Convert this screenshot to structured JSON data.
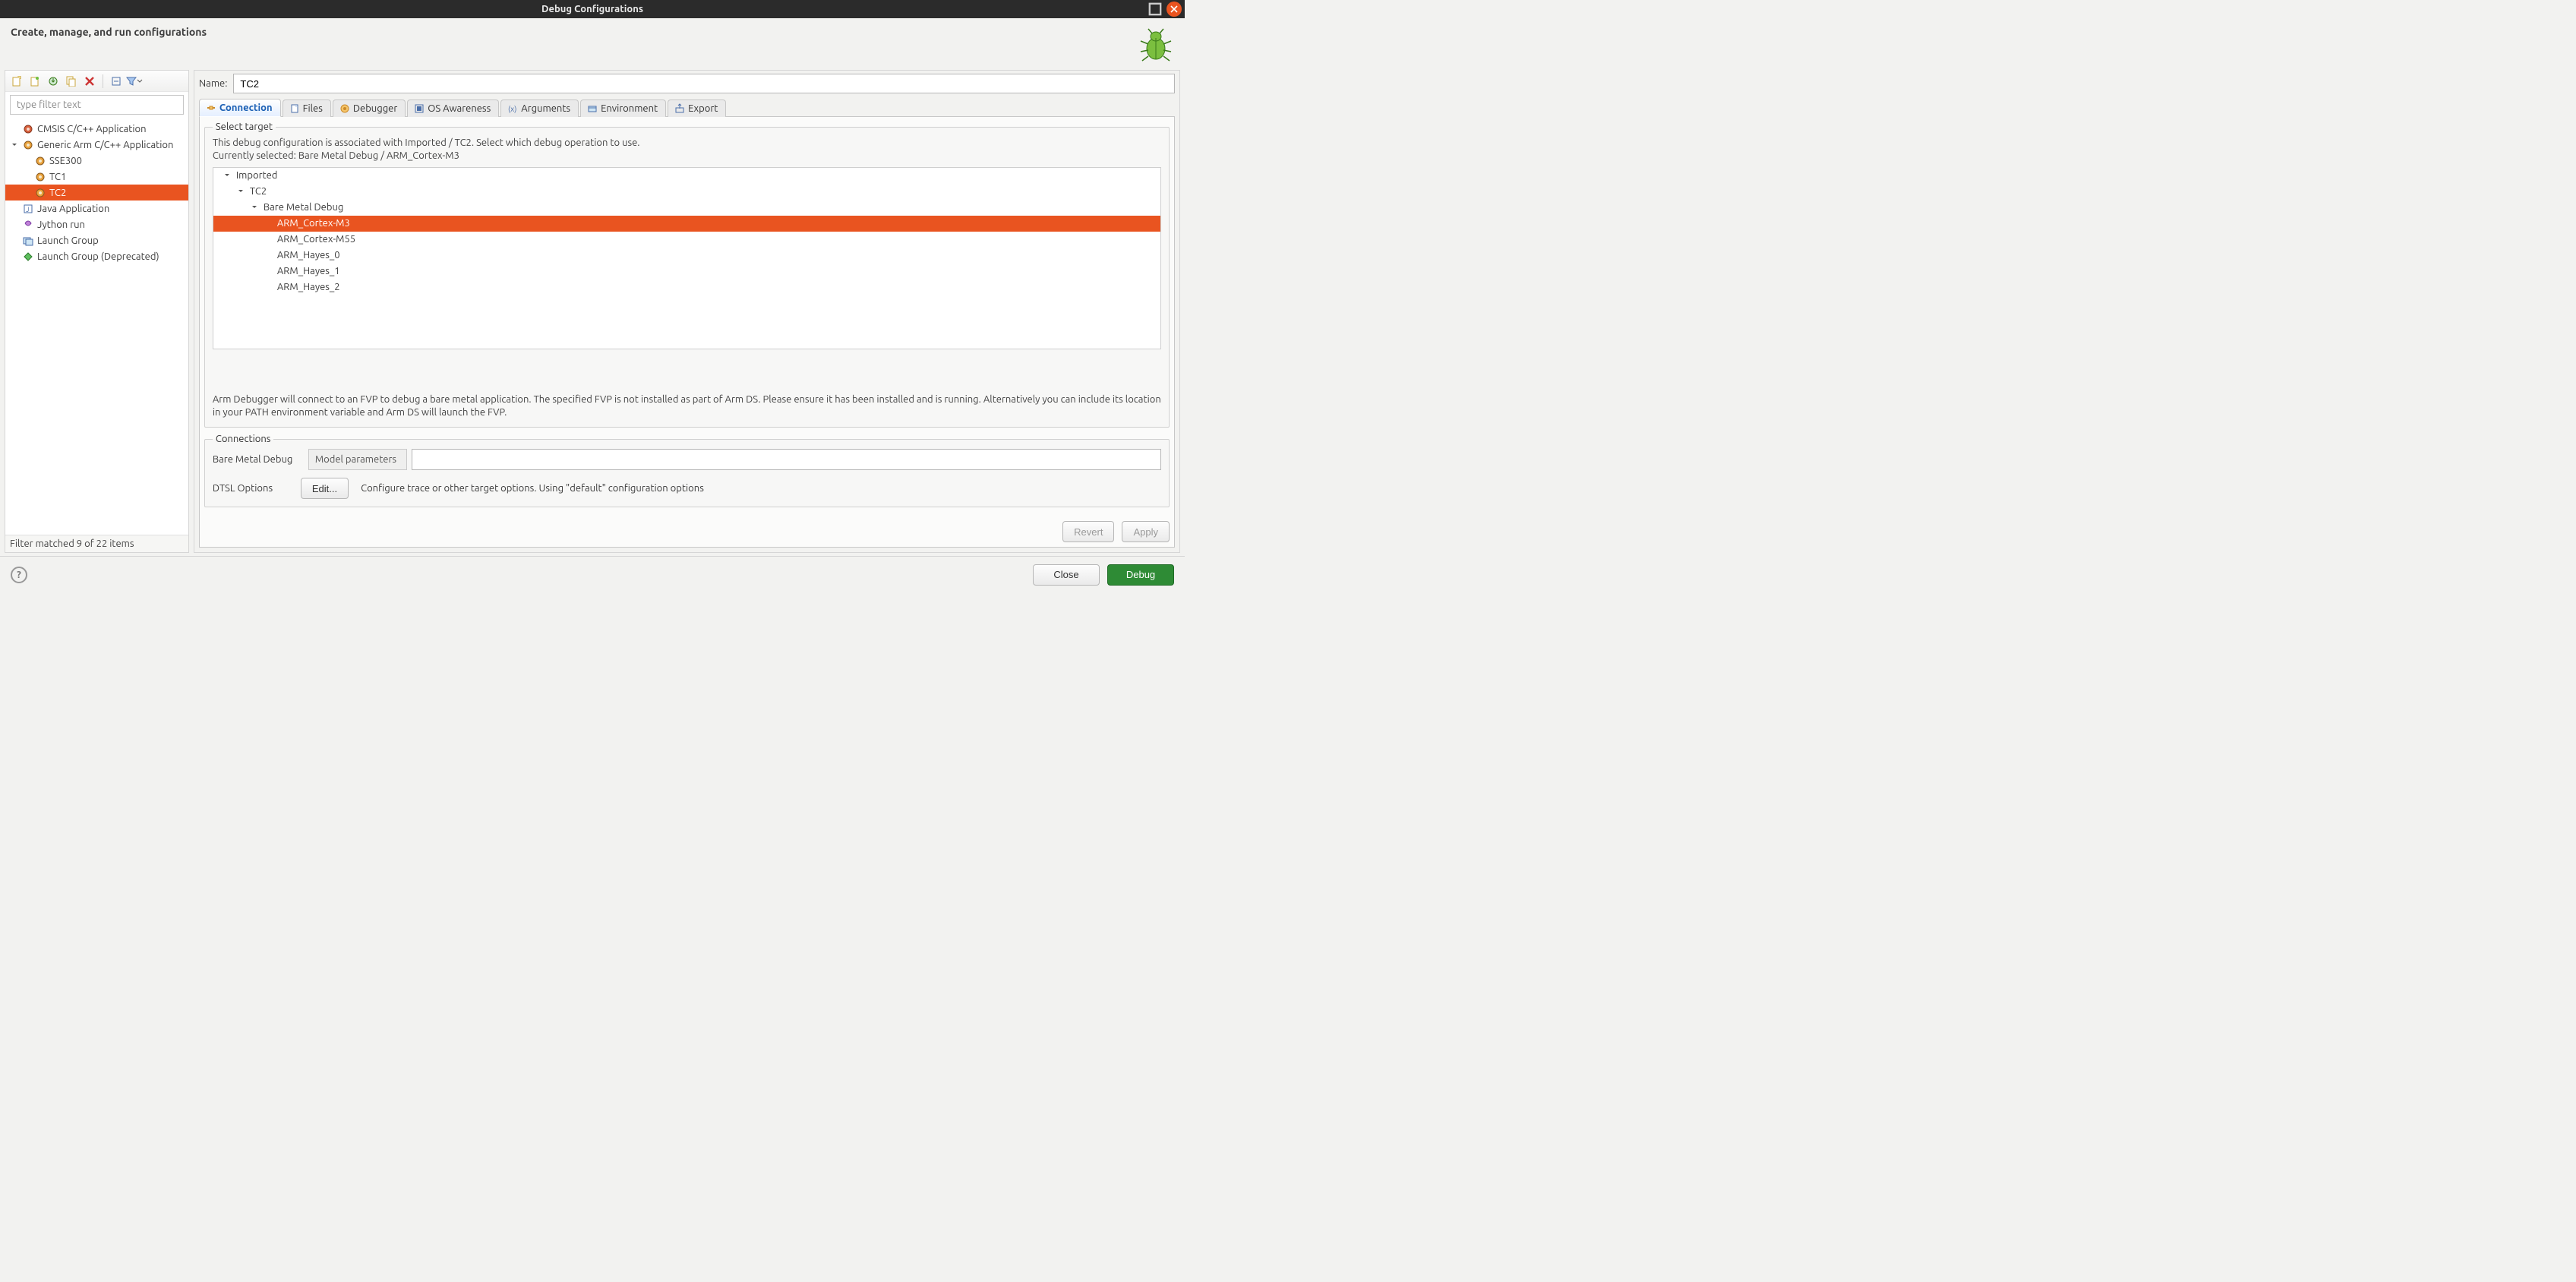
{
  "window": {
    "title": "Debug Configurations"
  },
  "header": {
    "title": "Create, manage, and run configurations"
  },
  "left": {
    "filter_placeholder": "type filter text",
    "tree": [
      {
        "label": "CMSIS C/C++ Application",
        "icon": "gear-red"
      },
      {
        "label": "Generic Arm C/C++ Application",
        "icon": "gear-orange",
        "expanded": true,
        "children": [
          {
            "label": "SSE300",
            "icon": "gear-orange"
          },
          {
            "label": "TC1",
            "icon": "gear-orange"
          },
          {
            "label": "TC2",
            "icon": "gear-orange",
            "selected": true
          }
        ]
      },
      {
        "label": "Java Application",
        "icon": "java"
      },
      {
        "label": "Jython run",
        "icon": "jython"
      },
      {
        "label": "Launch Group",
        "icon": "launch-group"
      },
      {
        "label": "Launch Group (Deprecated)",
        "icon": "launch-group-dep"
      }
    ],
    "filter_status": "Filter matched 9 of 22 items"
  },
  "right": {
    "name_label": "Name:",
    "name_value": "TC2",
    "tabs": [
      {
        "label": "Connection",
        "active": true
      },
      {
        "label": "Files"
      },
      {
        "label": "Debugger"
      },
      {
        "label": "OS Awareness"
      },
      {
        "label": "Arguments"
      },
      {
        "label": "Environment"
      },
      {
        "label": "Export"
      }
    ],
    "select_target": {
      "legend": "Select target",
      "desc_line1": "This debug configuration is associated with Imported / TC2. Select which debug operation to use.",
      "desc_line2": "Currently selected: Bare Metal Debug / ARM_Cortex-M3",
      "tree": [
        {
          "label": "Imported",
          "depth": 0,
          "expanded": true
        },
        {
          "label": "TC2",
          "depth": 1,
          "expanded": true
        },
        {
          "label": "Bare Metal Debug",
          "depth": 2,
          "expanded": true
        },
        {
          "label": "ARM_Cortex-M3",
          "depth": 3,
          "leaf": true,
          "selected": true
        },
        {
          "label": "ARM_Cortex-M55",
          "depth": 3,
          "leaf": true
        },
        {
          "label": "ARM_Hayes_0",
          "depth": 3,
          "leaf": true
        },
        {
          "label": "ARM_Hayes_1",
          "depth": 3,
          "leaf": true
        },
        {
          "label": "ARM_Hayes_2",
          "depth": 3,
          "leaf": true
        }
      ],
      "note": "Arm Debugger will connect to an FVP to debug a bare metal application. The specified FVP is not installed as part of Arm DS. Please ensure it has been installed and is running. Alternatively you can include its location in your PATH environment variable and Arm DS will launch the FVP."
    },
    "connections": {
      "legend": "Connections",
      "row_label": "Bare Metal Debug",
      "param_label": "Model parameters",
      "param_value": "",
      "dtsl_label": "DTSL Options",
      "edit_label": "Edit...",
      "dtsl_note": "Configure  trace or other target options. Using \"default\" configuration options"
    },
    "revert_label": "Revert",
    "apply_label": "Apply"
  },
  "bottom": {
    "close": "Close",
    "debug": "Debug"
  }
}
